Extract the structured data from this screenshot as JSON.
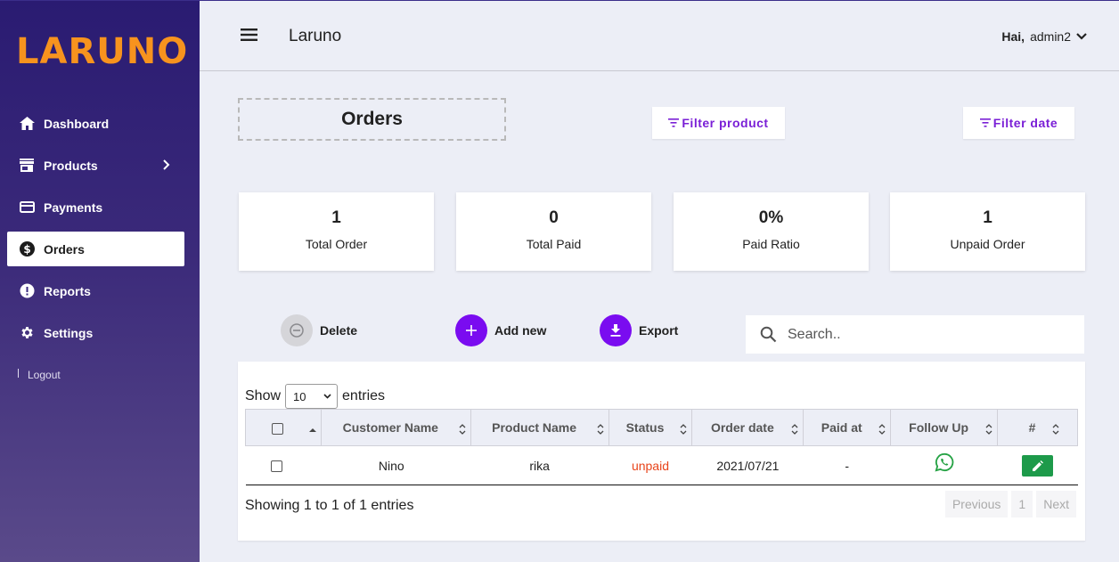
{
  "sidebar": {
    "logo": "LARUNO",
    "items": [
      {
        "label": "Dashboard",
        "icon": "home-icon"
      },
      {
        "label": "Products",
        "icon": "store-icon"
      },
      {
        "label": "Payments",
        "icon": "credit-card-icon"
      },
      {
        "label": "Orders",
        "icon": "dollar-circle-icon",
        "active": true
      },
      {
        "label": "Reports",
        "icon": "alert-circle-icon"
      },
      {
        "label": "Settings",
        "icon": "gear-icon"
      }
    ],
    "logout": "Logout"
  },
  "header": {
    "title": "Laruno",
    "greeting": "Hai,",
    "username": "admin2"
  },
  "page": {
    "title": "Orders",
    "filter_product": "Filter product",
    "filter_date": "Filter date"
  },
  "stats": [
    {
      "value": "1",
      "label": "Total Order"
    },
    {
      "value": "0",
      "label": "Total Paid"
    },
    {
      "value": "0%",
      "label": "Paid Ratio"
    },
    {
      "value": "1",
      "label": "Unpaid Order"
    }
  ],
  "actions": {
    "delete": "Delete",
    "add_new": "Add new",
    "export": "Export"
  },
  "search": {
    "placeholder": "Search.."
  },
  "table": {
    "show_label": "Show",
    "entries_label": "entries",
    "page_size": "10",
    "columns": [
      "Customer Name",
      "Product Name",
      "Status",
      "Order date",
      "Paid at",
      "Follow Up",
      "#"
    ],
    "rows": [
      {
        "customer": "Nino",
        "product": "rika",
        "status": "unpaid",
        "order_date": "2021/07/21",
        "paid_at": "-"
      }
    ],
    "info": "Showing 1 to 1 of 1 entries",
    "pagination": {
      "previous": "Previous",
      "page": "1",
      "next": "Next"
    }
  },
  "colors": {
    "accent": "#7a1fd6",
    "logo": "#f7931e",
    "sidebar": "#2a1b72",
    "status_unpaid": "#e8441a",
    "whatsapp": "#25a244",
    "edit": "#1d9a4a"
  }
}
